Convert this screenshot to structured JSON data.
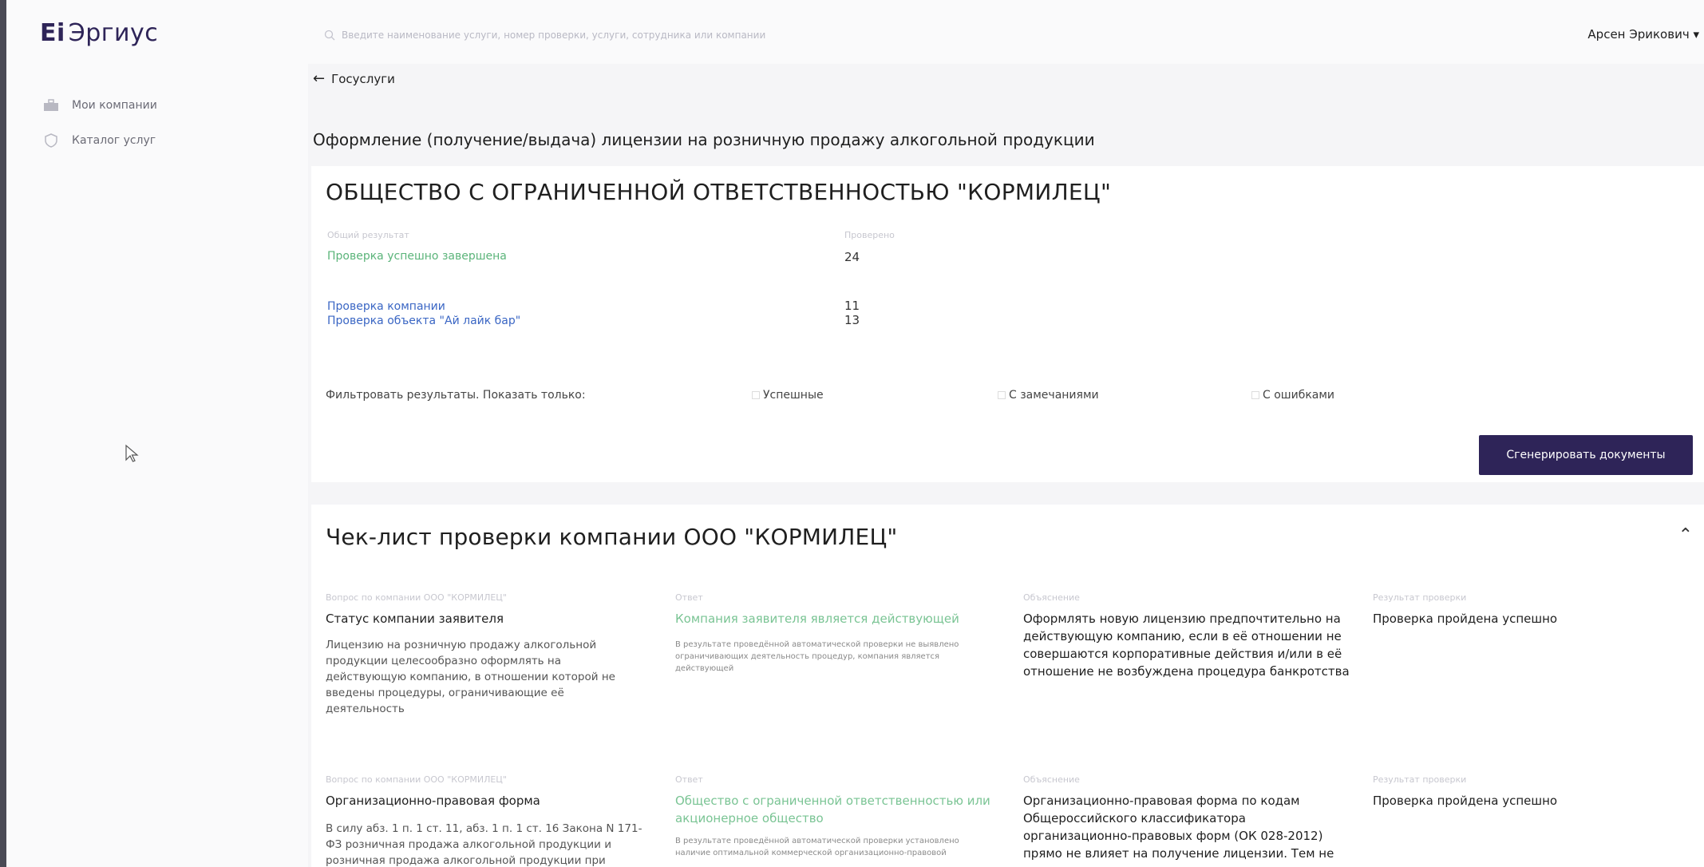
{
  "app": {
    "logo_mark": "Ei",
    "logo_text": "Эргиус",
    "search_placeholder": "Введите наименование услуги, номер проверки, услуги, сотрудника или компании",
    "user_name": "Арсен Эрикович ▾"
  },
  "sidebar": {
    "items": [
      {
        "label": "Мои компании",
        "icon": "briefcase-icon"
      },
      {
        "label": "Каталог услуг",
        "icon": "shield-icon"
      }
    ]
  },
  "breadcrumb": {
    "back_label": "Госуслуги"
  },
  "page_title": "Оформление (получение/выдача) лицензии на розничную продажу алкогольной продукции",
  "company_card": {
    "title": "ОБЩЕСТВО С ОГРАНИЧЕННОЙ ОТВЕТСТВЕННОСТЬЮ \"КОРМИЛЕЦ\"",
    "overall_label": "Общий результат",
    "overall_value": "Проверка успешно завершена",
    "checks_label": "Проверено",
    "checks_total": "24",
    "rows": [
      {
        "label": "Проверка компании",
        "value": "11"
      },
      {
        "label": "Проверка объекта \"Ай лайк бар\"",
        "value": "13"
      }
    ],
    "filter_label": "Фильтровать результаты. Показать только:",
    "filters": [
      "Успешные",
      "С замечаниями",
      "С ошибками"
    ],
    "generate_button": "Сгенерировать документы"
  },
  "checklist": {
    "title": "Чек-лист проверки компании ООО \"КОРМИЛЕЦ\"",
    "collapse_icon": "chevron-up-icon",
    "rows": [
      {
        "question_label": "Вопрос по компании ООО \"КОРМИЛЕЦ\"",
        "question_title": "Статус компании заявителя",
        "question_desc": "Лицензию на розничную продажу алкогольной продукции целесообразно оформлять на действующую компанию, в отношении которой не введены процедуры, ограничивающие её деятельность",
        "answer_label": "Ответ",
        "answer_title": "Компания заявителя является действующей",
        "answer_desc": "В результате проведённой автоматической проверки не выявлено ограничивающих деятельность процедур, компания является действующей",
        "explanation_label": "Объяснение",
        "explanation": "Оформлять новую лицензию предпочтительно на действующую компанию, если в её отношении не совершаются корпоративные действия и/или в её отношение не возбуждена процедура банкротства",
        "result_label": "Результат проверки",
        "result": "Проверка пройдена успешно"
      },
      {
        "question_label": "Вопрос по компании ООО \"КОРМИЛЕЦ\"",
        "question_title": "Организационно-правовая форма",
        "question_desc": "В силу абз. 1 п. 1 ст. 11, абз. 1 п. 1 ст. 16 Закона N 171-ФЗ розничная продажа алкогольной продукции и розничная продажа алкогольной продукции при",
        "answer_label": "Ответ",
        "answer_title": "Общество с ограниченной ответственностью или акционерное общество",
        "answer_desc": "В результате проведённой автоматической проверки установлено наличие оптимальной коммерческой организационно-правовой",
        "explanation_label": "Объяснение",
        "explanation": "Организационно-правовая форма по кодам Общероссийского классификатора организационно-правовых форм (ОК 028-2012) прямо не влияет на получение лицензии. Тем не",
        "result_label": "Результат проверки",
        "result": "Проверка пройдена успешно"
      }
    ]
  }
}
